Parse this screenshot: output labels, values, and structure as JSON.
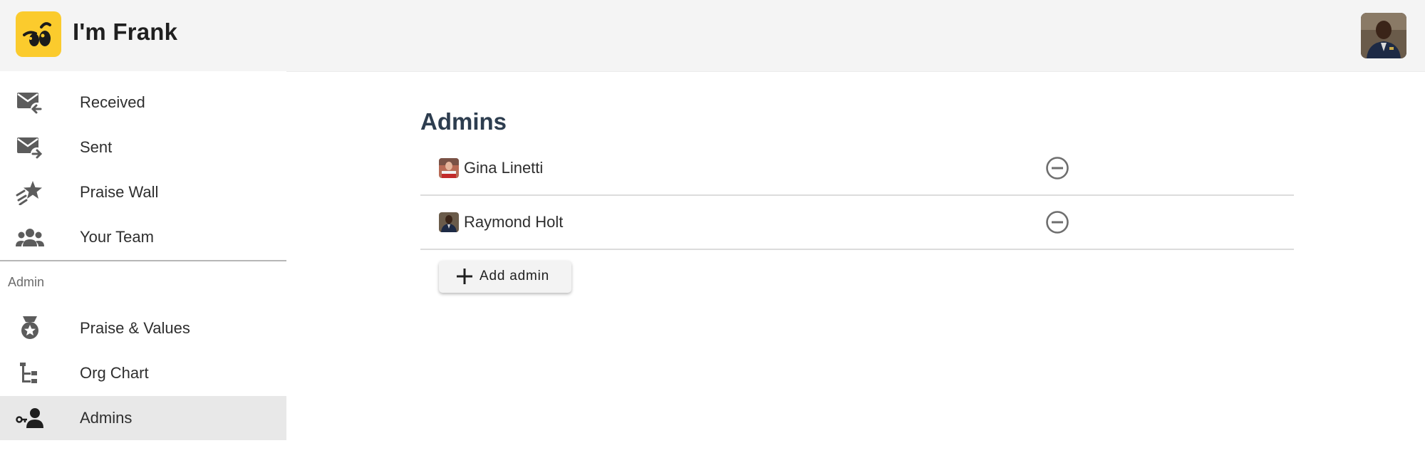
{
  "app": {
    "title": "I'm Frank",
    "logo_icon": "winking-face-logo",
    "brand_color": "#fbcb2d"
  },
  "header": {
    "user_avatar": "user-avatar-raymond-holt"
  },
  "sidebar": {
    "items": [
      {
        "label": "Received",
        "icon": "mail-received-icon"
      },
      {
        "label": "Sent",
        "icon": "mail-sent-icon"
      },
      {
        "label": "Praise Wall",
        "icon": "shooting-star-icon"
      },
      {
        "label": "Your Team",
        "icon": "people-icon"
      }
    ],
    "section_label": "Admin",
    "admin_items": [
      {
        "label": "Praise & Values",
        "icon": "medal-icon"
      },
      {
        "label": "Org Chart",
        "icon": "org-chart-icon"
      },
      {
        "label": "Admins",
        "icon": "admin-key-icon",
        "active": true
      }
    ],
    "active_color": "#e8e8e8"
  },
  "main": {
    "title": "Admins",
    "admins": [
      {
        "name": "Gina Linetti",
        "action_icon": "remove-circle-icon"
      },
      {
        "name": "Raymond Holt",
        "action_icon": "remove-circle-icon"
      }
    ],
    "add_button_label": "Add admin",
    "add_button_icon": "plus-icon",
    "title_color": "#2d3d4f"
  }
}
